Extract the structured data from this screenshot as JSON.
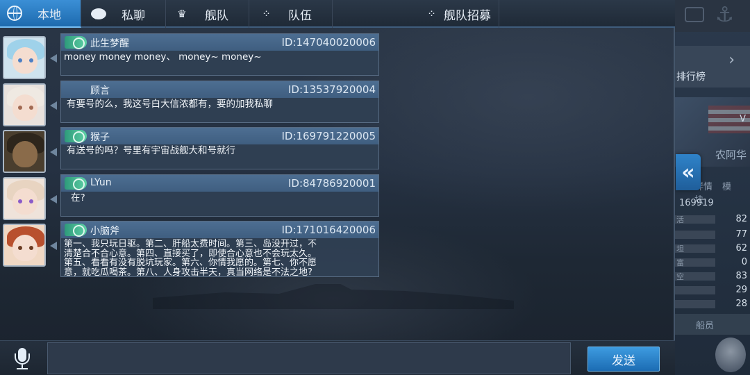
{
  "tabs": [
    {
      "label": "本地",
      "icon": "globe-icon",
      "active": true
    },
    {
      "label": "私聊",
      "icon": "chat-bubble-icon",
      "active": false
    },
    {
      "label": "舰队",
      "icon": "fleet-emblem-icon",
      "active": false
    },
    {
      "label": "队伍",
      "icon": "team-dots-icon",
      "active": false
    },
    {
      "label": "舰队招募",
      "icon": "recruit-dots-icon",
      "active": false
    }
  ],
  "messages": [
    {
      "name": "此生梦醒",
      "id": "ID:147040020006",
      "text": "money money money、 money~ money~",
      "badge": true
    },
    {
      "name": "顾言",
      "id": "ID:13537920004",
      "text": "有要号的么，我这号白大信浓都有，要的加我私聊",
      "badge": false
    },
    {
      "name": "猴子",
      "id": "ID:169791220005",
      "text": "有送号的吗？号里有宇宙战舰大和号就行",
      "badge": true
    },
    {
      "name": "LYun",
      "id": "ID:84786920001",
      "text": "在?",
      "badge": true
    },
    {
      "name": "小脑斧",
      "id": "ID:171016420006",
      "text": "第一、我只玩日驱。第二、肝船太费时间。第三、岛没开过，不\n清楚合不合心意。第四、直接买了，即使合心意也不会玩太久。\n第五、看看有没有脱坑玩家。第六、你情我愿的。第七、你不愿\n意，就吃瓜喝茶。第八、人身攻击半天，真当网络是不法之地?",
      "badge": true
    }
  ],
  "input": {
    "value": "",
    "placeholder": ""
  },
  "send_label": "发送",
  "side_panel": {
    "rank_text": "排行榜",
    "ship_suffix": "V",
    "ship_name": "农阿华",
    "tabs": [
      "详情",
      "模块"
    ],
    "power": "169919",
    "stats": [
      {
        "label": "活",
        "value": "82"
      },
      {
        "label": "",
        "value": "77"
      },
      {
        "label": "坦",
        "value": "62"
      },
      {
        "label": "富",
        "value": "0"
      },
      {
        "label": "空",
        "value": "83"
      },
      {
        "label": "",
        "value": "29"
      },
      {
        "label": "",
        "value": "28"
      }
    ],
    "crew_label": "船员"
  },
  "colors": {
    "accent": "#2f86cf",
    "badge": "#3fb590",
    "panel": "#304054"
  }
}
